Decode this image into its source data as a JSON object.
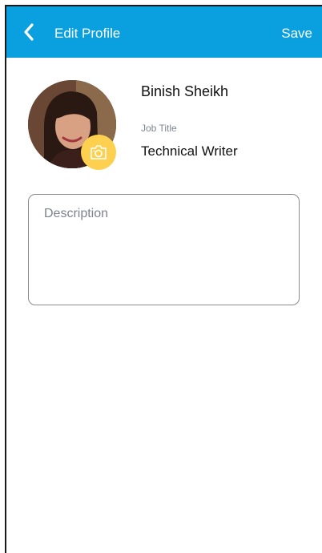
{
  "appbar": {
    "title": "Edit Profile",
    "save_label": "Save",
    "background": "#0A9FDE",
    "back_icon": "chevron-left-icon"
  },
  "profile": {
    "name": "Binish Sheikh",
    "job_title_label": "Job Title",
    "job_title_value": "Technical Writer",
    "camera_icon": "camera-icon",
    "camera_badge_color": "#FDD04F"
  },
  "description": {
    "placeholder": "Description",
    "value": ""
  }
}
